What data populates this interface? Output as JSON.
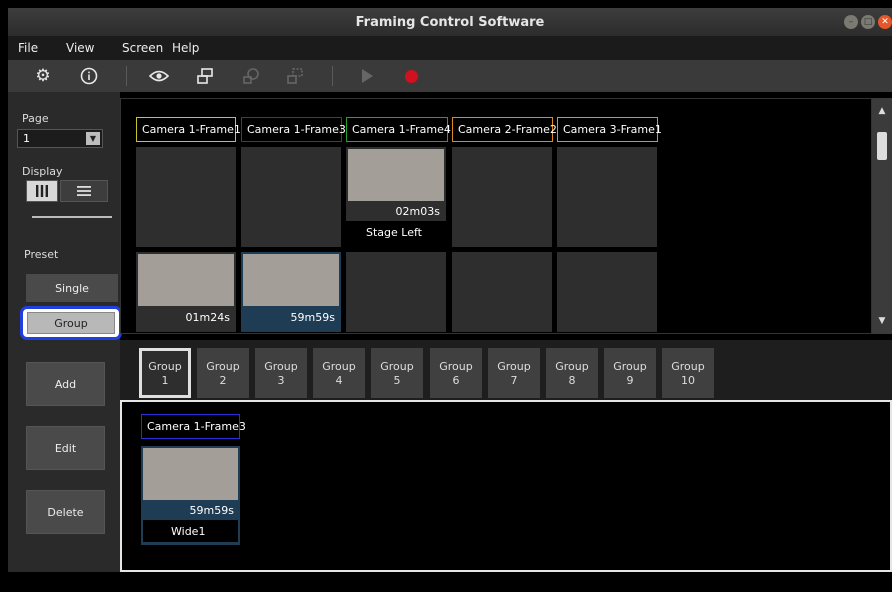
{
  "window": {
    "title": "Framing Control Software"
  },
  "menu": {
    "items": [
      "File",
      "View",
      "Screen",
      "Help"
    ]
  },
  "toolbar": {
    "icons": [
      "gear-icon",
      "info-icon",
      "eye-icon",
      "frame-arrange-icon",
      "frame-add-icon",
      "frame-layout-icon",
      "play-icon",
      "record-icon"
    ],
    "record_color": "#d1111e"
  },
  "left_panel": {
    "page_label": "Page",
    "page_value": "1",
    "display_label": "Display",
    "preset_label": "Preset",
    "single_label": "Single",
    "group_label": "Group",
    "add_label": "Add",
    "edit_label": "Edit",
    "delete_label": "Delete",
    "selection_color": "#1f3fe0"
  },
  "frames": {
    "labels": [
      {
        "text": "Camera 1-Frame1",
        "color": "#c9c229"
      },
      {
        "text": "Camera 1-Frame3",
        "color": "#2c2cd8"
      },
      {
        "text": "Camera 1-Frame4",
        "color": "#1fa52a"
      },
      {
        "text": "Camera 2-Frame2",
        "color": "#e08a1e"
      },
      {
        "text": "Camera 3-Frame1",
        "color": "#e07a9a"
      }
    ],
    "cells_row1": [
      {
        "time": "",
        "name": ""
      },
      {
        "time": "",
        "name": ""
      },
      {
        "time": "02m03s",
        "name": "Stage Left"
      },
      {
        "time": "",
        "name": ""
      },
      {
        "time": "",
        "name": ""
      }
    ],
    "cells_row2": [
      {
        "time": "01m24s",
        "selected": false
      },
      {
        "time": "59m59s",
        "selected": true
      },
      {
        "time": ""
      },
      {
        "time": ""
      },
      {
        "time": ""
      }
    ]
  },
  "groups": {
    "tabs": [
      {
        "line1": "Group",
        "line2": "1"
      },
      {
        "line1": "Group",
        "line2": "2"
      },
      {
        "line1": "Group",
        "line2": "3"
      },
      {
        "line1": "Group",
        "line2": "4"
      },
      {
        "line1": "Group",
        "line2": "5"
      },
      {
        "line1": "Group",
        "line2": "6"
      },
      {
        "line1": "Group",
        "line2": "7"
      },
      {
        "line1": "Group",
        "line2": "8"
      },
      {
        "line1": "Group",
        "line2": "9"
      },
      {
        "line1": "Group",
        "line2": "10"
      }
    ],
    "active_index": 0
  },
  "group_content": {
    "label": "Camera 1-Frame3",
    "label_color": "#2c2cd8",
    "time": "59m59s",
    "name": "Wide1"
  }
}
